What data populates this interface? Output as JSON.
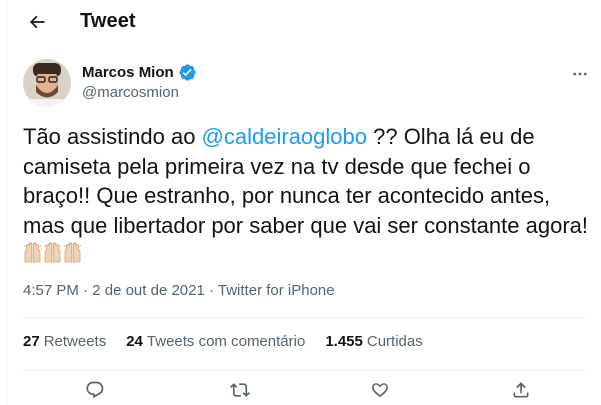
{
  "header": {
    "title": "Tweet"
  },
  "author": {
    "name": "Marcos Mion",
    "handle": "@marcosmion"
  },
  "tweet": {
    "text_before": "Tão assistindo ao ",
    "mention": "@caldeiraoglobo",
    "text_after": " ?? Olha lá eu de camiseta pela primeira vez na tv desde que fechei o braço!! Que estranho, por nunca ter acontecido antes, mas que libertador por saber que vai ser constante agora!",
    "emoji": [
      "raising-hands-icon",
      "raising-hands-icon",
      "raising-hands-icon"
    ]
  },
  "meta": {
    "time": "4:57 PM",
    "sep1": " · ",
    "date": "2 de out de 2021",
    "sep2": " · ",
    "source": "Twitter for iPhone"
  },
  "stats": {
    "retweets_count": "27",
    "retweets_label": "Retweets",
    "quotes_count": "24",
    "quotes_label": "Tweets com comentário",
    "likes_count": "1.455",
    "likes_label": "Curtidas"
  },
  "colors": {
    "accent": "#1d9bf0",
    "text": "#0f1419",
    "secondary": "#536471",
    "border": "#eff3f4"
  }
}
